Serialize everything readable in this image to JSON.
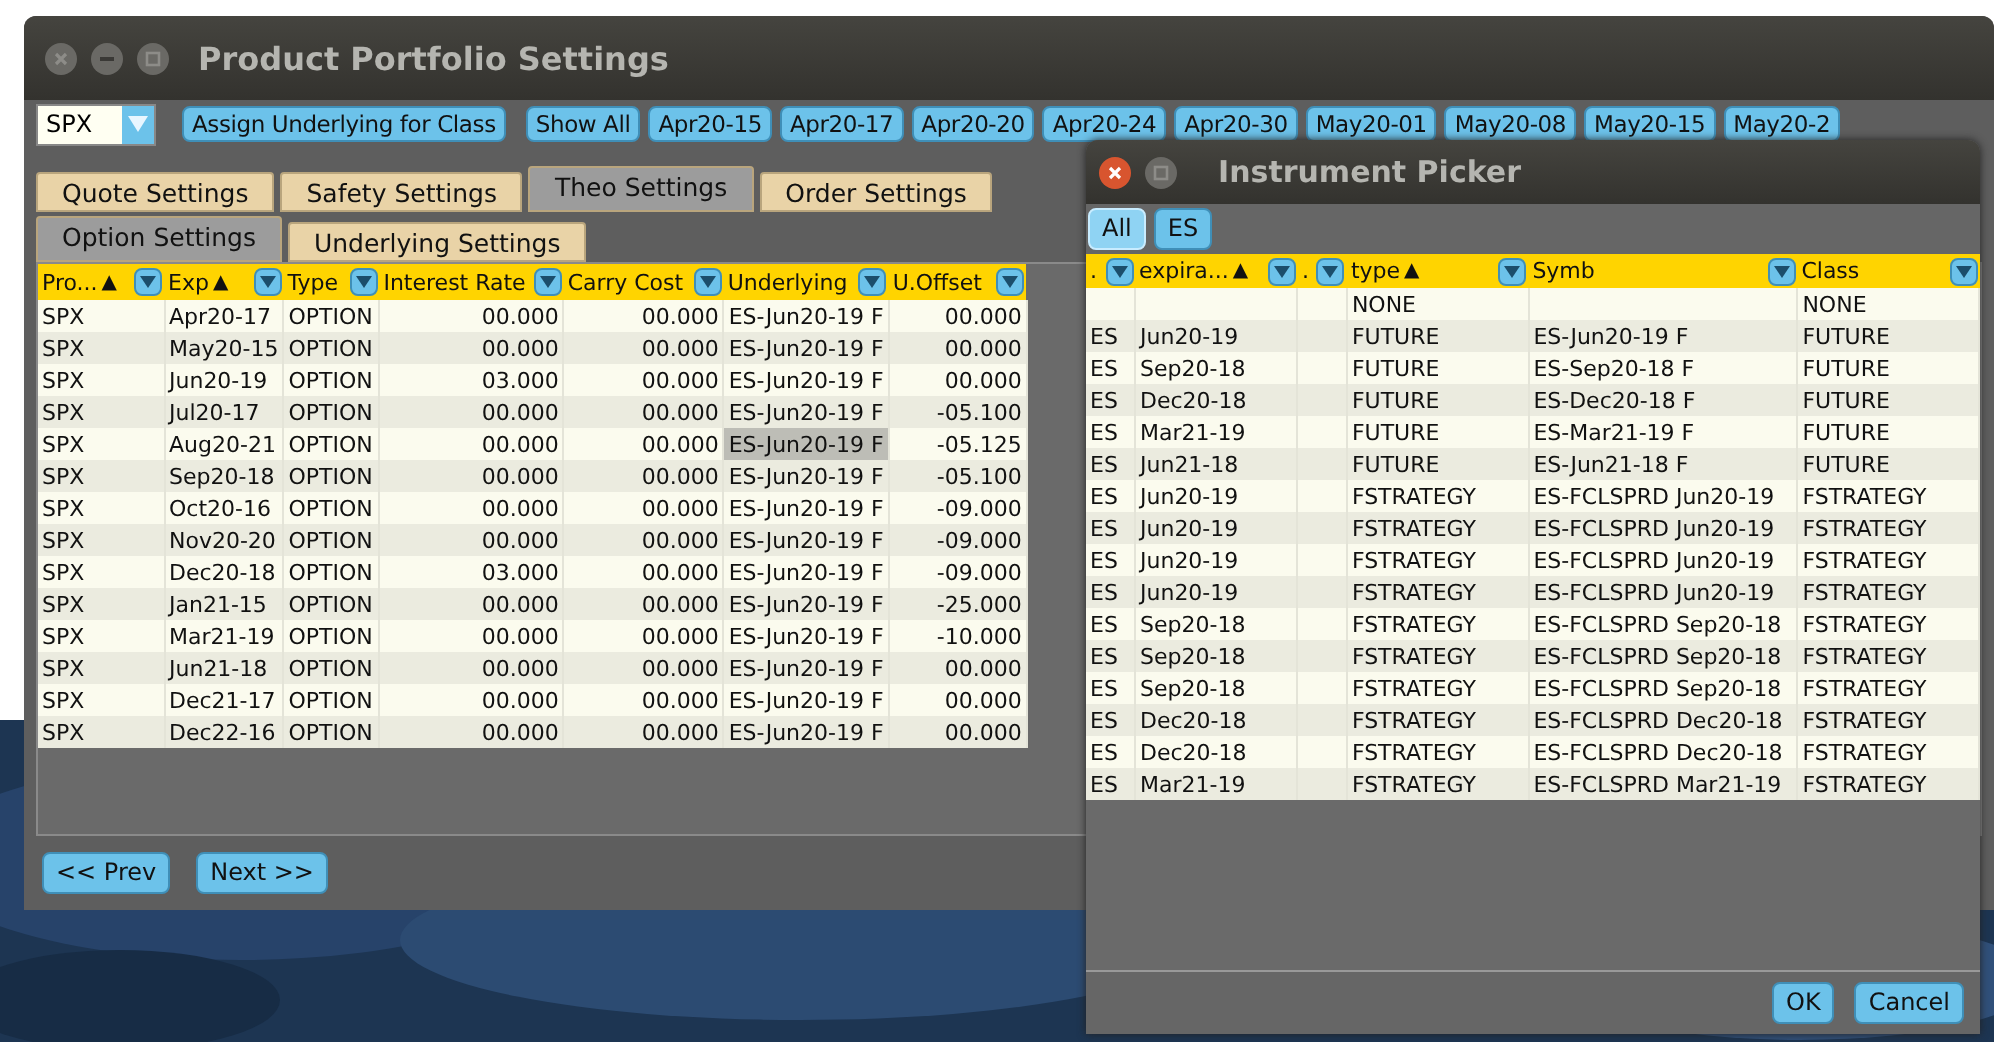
{
  "main_window": {
    "title": "Product Portfolio Settings",
    "class_combo": {
      "value": "SPX"
    },
    "assign_button": "Assign Underlying for Class",
    "show_all_button": "Show All",
    "expiry_buttons": [
      "Apr20-15",
      "Apr20-17",
      "Apr20-20",
      "Apr20-24",
      "Apr20-30",
      "May20-01",
      "May20-08",
      "May20-15",
      "May20-2"
    ],
    "tabs": [
      {
        "label": "Quote Settings",
        "selected": false
      },
      {
        "label": "Safety Settings",
        "selected": false
      },
      {
        "label": "Theo Settings",
        "selected": true
      },
      {
        "label": "Order Settings",
        "selected": false
      }
    ],
    "subtabs": [
      {
        "label": "Option Settings",
        "selected": true
      },
      {
        "label": "Underlying Settings",
        "selected": false
      }
    ],
    "table": {
      "columns": [
        {
          "label": "Pro...",
          "sort": "▲"
        },
        {
          "label": "Exp",
          "sort": "▲"
        },
        {
          "label": "Type"
        },
        {
          "label": "Interest Rate"
        },
        {
          "label": "Carry Cost"
        },
        {
          "label": "Underlying"
        },
        {
          "label": "U.Offset"
        }
      ],
      "rows": [
        {
          "cells": [
            "SPX",
            "Apr20-17",
            "OPTION",
            "00.000",
            "00.000",
            "ES-Jun20-19 F",
            "00.000"
          ],
          "underlying_selected": false
        },
        {
          "cells": [
            "SPX",
            "May20-15",
            "OPTION",
            "00.000",
            "00.000",
            "ES-Jun20-19 F",
            "00.000"
          ],
          "underlying_selected": false
        },
        {
          "cells": [
            "SPX",
            "Jun20-19",
            "OPTION",
            "03.000",
            "00.000",
            "ES-Jun20-19 F",
            "00.000"
          ],
          "underlying_selected": false
        },
        {
          "cells": [
            "SPX",
            "Jul20-17",
            "OPTION",
            "00.000",
            "00.000",
            "ES-Jun20-19 F",
            "-05.100"
          ],
          "underlying_selected": false
        },
        {
          "cells": [
            "SPX",
            "Aug20-21",
            "OPTION",
            "00.000",
            "00.000",
            "ES-Jun20-19 F",
            "-05.125"
          ],
          "underlying_selected": true
        },
        {
          "cells": [
            "SPX",
            "Sep20-18",
            "OPTION",
            "00.000",
            "00.000",
            "ES-Jun20-19 F",
            "-05.100"
          ],
          "underlying_selected": false
        },
        {
          "cells": [
            "SPX",
            "Oct20-16",
            "OPTION",
            "00.000",
            "00.000",
            "ES-Jun20-19 F",
            "-09.000"
          ],
          "underlying_selected": false
        },
        {
          "cells": [
            "SPX",
            "Nov20-20",
            "OPTION",
            "00.000",
            "00.000",
            "ES-Jun20-19 F",
            "-09.000"
          ],
          "underlying_selected": false
        },
        {
          "cells": [
            "SPX",
            "Dec20-18",
            "OPTION",
            "03.000",
            "00.000",
            "ES-Jun20-19 F",
            "-09.000"
          ],
          "underlying_selected": false
        },
        {
          "cells": [
            "SPX",
            "Jan21-15",
            "OPTION",
            "00.000",
            "00.000",
            "ES-Jun20-19 F",
            "-25.000"
          ],
          "underlying_selected": false
        },
        {
          "cells": [
            "SPX",
            "Mar21-19",
            "OPTION",
            "00.000",
            "00.000",
            "ES-Jun20-19 F",
            "-10.000"
          ],
          "underlying_selected": false
        },
        {
          "cells": [
            "SPX",
            "Jun21-18",
            "OPTION",
            "00.000",
            "00.000",
            "ES-Jun20-19 F",
            "00.000"
          ],
          "underlying_selected": false
        },
        {
          "cells": [
            "SPX",
            "Dec21-17",
            "OPTION",
            "00.000",
            "00.000",
            "ES-Jun20-19 F",
            "00.000"
          ],
          "underlying_selected": false
        },
        {
          "cells": [
            "SPX",
            "Dec22-16",
            "OPTION",
            "00.000",
            "00.000",
            "ES-Jun20-19 F",
            "00.000"
          ],
          "underlying_selected": false
        }
      ]
    },
    "prev_button": "<< Prev",
    "next_button": "Next >>"
  },
  "picker": {
    "title": "Instrument Picker",
    "filters": [
      {
        "label": "All",
        "selected": true
      },
      {
        "label": "ES",
        "selected": false
      }
    ],
    "table": {
      "columns": [
        {
          "label": "."
        },
        {
          "label": "expira...",
          "sort": "▲"
        },
        {
          "label": "."
        },
        {
          "label": "type",
          "sort": "▲"
        },
        {
          "label": "Symb"
        },
        {
          "label": "Class"
        }
      ],
      "rows": [
        {
          "cells": [
            null,
            null,
            null,
            "NONE",
            null,
            "NONE"
          ]
        },
        {
          "cells": [
            "ES",
            "Jun20-19",
            null,
            "FUTURE",
            "ES-Jun20-19 F",
            "FUTURE"
          ]
        },
        {
          "cells": [
            "ES",
            "Sep20-18",
            null,
            "FUTURE",
            "ES-Sep20-18 F",
            "FUTURE"
          ]
        },
        {
          "cells": [
            "ES",
            "Dec20-18",
            null,
            "FUTURE",
            "ES-Dec20-18 F",
            "FUTURE"
          ]
        },
        {
          "cells": [
            "ES",
            "Mar21-19",
            null,
            "FUTURE",
            "ES-Mar21-19 F",
            "FUTURE"
          ]
        },
        {
          "cells": [
            "ES",
            "Jun21-18",
            null,
            "FUTURE",
            "ES-Jun21-18 F",
            "FUTURE"
          ]
        },
        {
          "cells": [
            "ES",
            "Jun20-19",
            null,
            "FSTRATEGY",
            "ES-FCLSPRD Jun20-19",
            "FSTRATEGY"
          ]
        },
        {
          "cells": [
            "ES",
            "Jun20-19",
            null,
            "FSTRATEGY",
            "ES-FCLSPRD Jun20-19",
            "FSTRATEGY"
          ]
        },
        {
          "cells": [
            "ES",
            "Jun20-19",
            null,
            "FSTRATEGY",
            "ES-FCLSPRD Jun20-19",
            "FSTRATEGY"
          ]
        },
        {
          "cells": [
            "ES",
            "Jun20-19",
            null,
            "FSTRATEGY",
            "ES-FCLSPRD Jun20-19",
            "FSTRATEGY"
          ]
        },
        {
          "cells": [
            "ES",
            "Sep20-18",
            null,
            "FSTRATEGY",
            "ES-FCLSPRD Sep20-18",
            "FSTRATEGY"
          ]
        },
        {
          "cells": [
            "ES",
            "Sep20-18",
            null,
            "FSTRATEGY",
            "ES-FCLSPRD Sep20-18",
            "FSTRATEGY"
          ]
        },
        {
          "cells": [
            "ES",
            "Sep20-18",
            null,
            "FSTRATEGY",
            "ES-FCLSPRD Sep20-18",
            "FSTRATEGY"
          ]
        },
        {
          "cells": [
            "ES",
            "Dec20-18",
            null,
            "FSTRATEGY",
            "ES-FCLSPRD Dec20-18",
            "FSTRATEGY"
          ]
        },
        {
          "cells": [
            "ES",
            "Dec20-18",
            null,
            "FSTRATEGY",
            "ES-FCLSPRD Dec20-18",
            "FSTRATEGY"
          ]
        },
        {
          "cells": [
            "ES",
            "Mar21-19",
            null,
            "FSTRATEGY",
            "ES-FCLSPRD Mar21-19",
            "FSTRATEGY"
          ]
        }
      ]
    },
    "ok_button": "OK",
    "cancel_button": "Cancel"
  }
}
